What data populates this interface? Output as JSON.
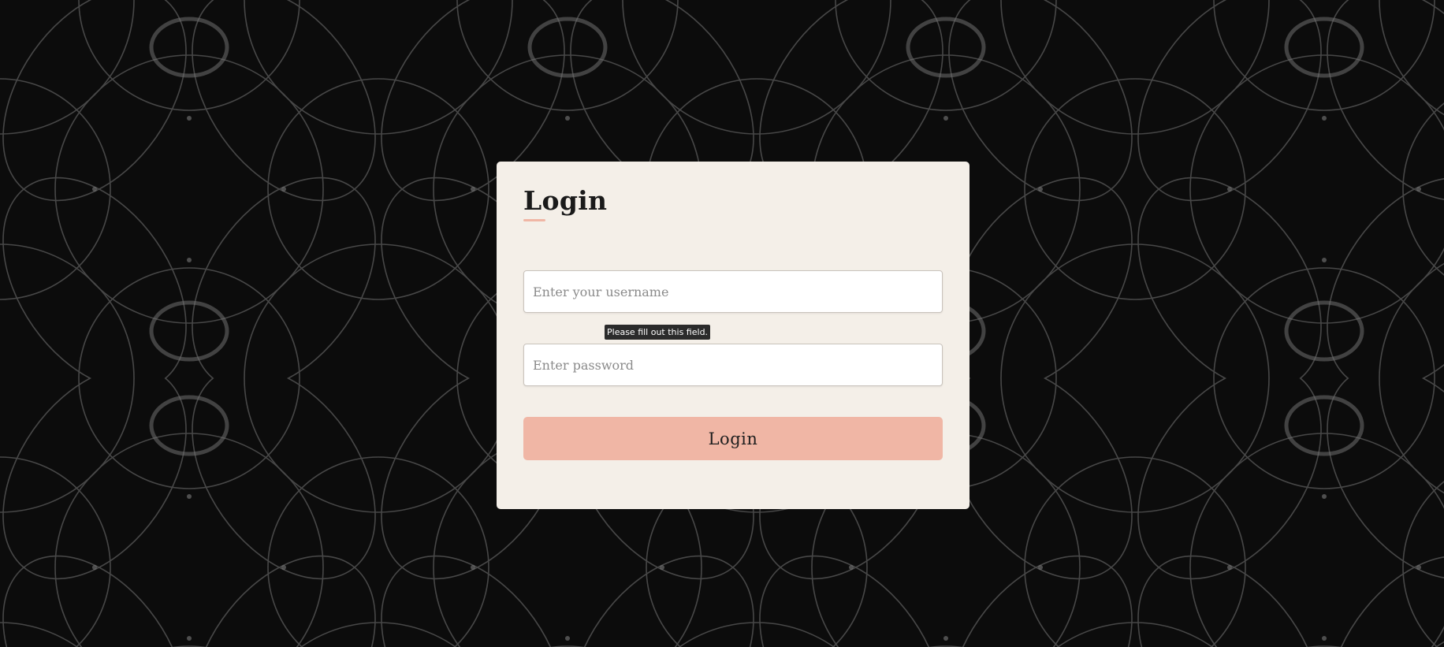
{
  "page": {
    "background_color": "#0c0c0c"
  },
  "login_form": {
    "title": "Login",
    "username": {
      "value": "",
      "placeholder": "Enter your username"
    },
    "password": {
      "value": "",
      "placeholder": "Enter password"
    },
    "validation_tooltip": "Please fill out this field.",
    "submit_label": "Login",
    "colors": {
      "card_background": "#f4efe8",
      "accent": "#f0b6a5",
      "tooltip_background": "#2b2b2b"
    }
  }
}
